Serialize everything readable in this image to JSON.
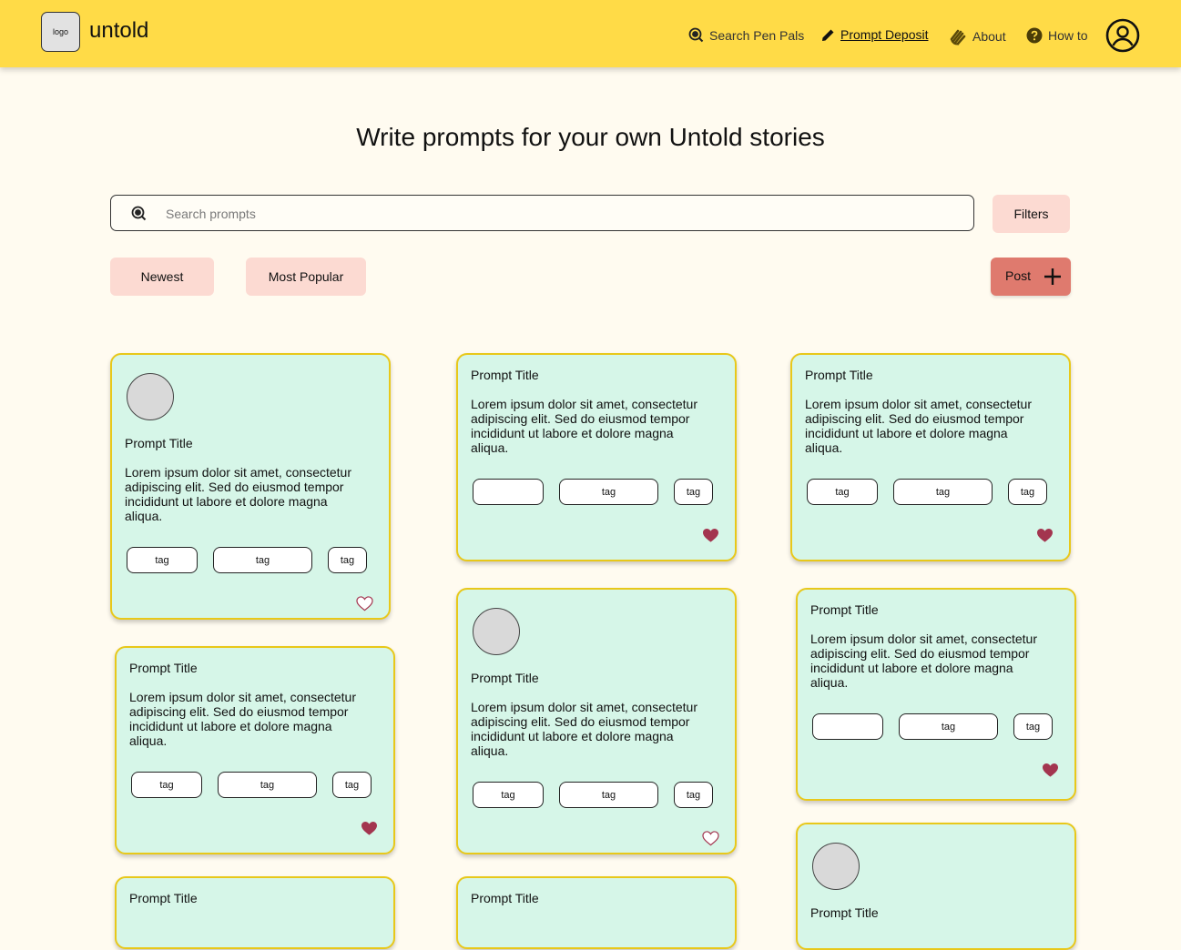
{
  "header": {
    "logo_text": "logo",
    "brand": "untold",
    "nav": [
      {
        "label": "Search Pen Pals",
        "icon": "search-icon"
      },
      {
        "label": "Prompt Deposit",
        "icon": "pencil-icon",
        "active": true
      },
      {
        "label": "About",
        "icon": "waving-hand-icon"
      },
      {
        "label": "How to",
        "icon": "question-icon"
      }
    ],
    "profile_icon": "user-circle-icon"
  },
  "page": {
    "title": "Write prompts for your own Untold stories"
  },
  "search": {
    "placeholder": "Search prompts",
    "value": "",
    "filters_label": "Filters"
  },
  "sort": {
    "newest_label": "Newest",
    "popular_label": "Most Popular"
  },
  "post_button": {
    "label": "Post",
    "icon": "plus-icon"
  },
  "colors": {
    "header": "#ffdb47",
    "page_bg": "#fffbf0",
    "card_bg": "#d6f6e8",
    "card_border": "#e8c81a",
    "pill_bg": "#fcdad2",
    "post_bg": "#df7a6e",
    "heart_filled": "#a3354f"
  },
  "cards": [
    {
      "title": "Prompt Title",
      "body": "Lorem ipsum dolor sit amet, consectetur adipiscing elit. Sed do eiusmod tempor incididunt ut labore et dolore magna aliqua.",
      "tags": [
        "tag",
        "tag",
        "tag"
      ],
      "has_avatar": true,
      "liked": false
    },
    {
      "title": "Prompt Title",
      "body": "Lorem ipsum dolor sit amet, consectetur adipiscing elit. Sed do eiusmod tempor incididunt ut labore et dolore magna aliqua.",
      "tags": [
        "",
        "tag",
        "tag"
      ],
      "has_avatar": false,
      "liked": true
    },
    {
      "title": "Prompt Title",
      "body": "Lorem ipsum dolor sit amet, consectetur adipiscing elit. Sed do eiusmod tempor incididunt ut labore et dolore magna aliqua.",
      "tags": [
        "tag",
        "tag",
        "tag"
      ],
      "has_avatar": false,
      "liked": true
    },
    {
      "title": "Prompt Title",
      "body": "Lorem ipsum dolor sit amet, consectetur adipiscing elit. Sed do eiusmod tempor incididunt ut labore et dolore magna aliqua.",
      "tags": [
        "tag",
        "tag",
        "tag"
      ],
      "has_avatar": false,
      "liked": true
    },
    {
      "title": "Prompt Title",
      "body": "Lorem ipsum dolor sit amet, consectetur adipiscing elit. Sed do eiusmod tempor incididunt ut labore et dolore magna aliqua.",
      "tags": [
        "tag",
        "tag",
        "tag"
      ],
      "has_avatar": true,
      "liked": false
    },
    {
      "title": "Prompt Title",
      "body": "Lorem ipsum dolor sit amet, consectetur adipiscing elit. Sed do eiusmod tempor incididunt ut labore et dolore magna aliqua.",
      "tags": [
        "",
        "tag",
        "tag"
      ],
      "has_avatar": false,
      "liked": true
    },
    {
      "title": "Prompt Title",
      "has_avatar": false
    },
    {
      "title": "Prompt Title",
      "has_avatar": false
    },
    {
      "title": "Prompt Title",
      "has_avatar": true
    }
  ]
}
